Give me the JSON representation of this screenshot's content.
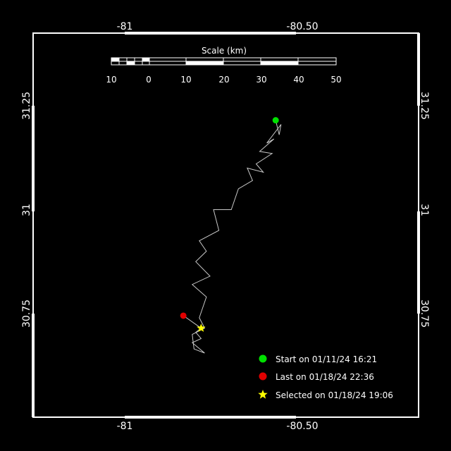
{
  "axes": {
    "lon_ticks": [
      "-81",
      "-80.50"
    ],
    "lat_ticks": [
      "31.25",
      "31",
      "30.75"
    ]
  },
  "scale_bar": {
    "title": "Scale (km)",
    "labels": [
      "10",
      "0",
      "10",
      "20",
      "30",
      "40",
      "50"
    ]
  },
  "legend": {
    "start": "Start on 01/11/24 16:21",
    "last": "Last on 01/18/24 22:36",
    "selected": "Selected on 01/18/24 19:06"
  },
  "colors": {
    "background": "#000000",
    "frame": "#ffffff",
    "track": "#c8c8c8",
    "start": "#00e000",
    "last": "#e00000",
    "selected": "#ffff00"
  },
  "track": {
    "points_lonlat": [
      [
        -80.575,
        31.215
      ],
      [
        -80.565,
        31.18
      ],
      [
        -80.56,
        31.205
      ],
      [
        -80.6,
        31.16
      ],
      [
        -80.58,
        31.17
      ],
      [
        -80.62,
        31.14
      ],
      [
        -80.585,
        31.135
      ],
      [
        -80.63,
        31.11
      ],
      [
        -80.61,
        31.09
      ],
      [
        -80.655,
        31.1
      ],
      [
        -80.64,
        31.07
      ],
      [
        -80.68,
        31.05
      ],
      [
        -80.7,
        31.0
      ],
      [
        -80.75,
        31.0
      ],
      [
        -80.735,
        30.95
      ],
      [
        -80.79,
        30.925
      ],
      [
        -80.77,
        30.9
      ],
      [
        -80.8,
        30.875
      ],
      [
        -80.76,
        30.84
      ],
      [
        -80.81,
        30.82
      ],
      [
        -80.77,
        30.79
      ],
      [
        -80.79,
        30.74
      ],
      [
        -80.775,
        30.715
      ],
      [
        -80.81,
        30.7
      ],
      [
        -80.805,
        30.665
      ],
      [
        -80.775,
        30.655
      ],
      [
        -80.81,
        30.68
      ],
      [
        -80.785,
        30.69
      ],
      [
        -80.8,
        30.705
      ],
      [
        -80.785,
        30.715
      ],
      [
        -80.835,
        30.745
      ]
    ],
    "start_lonlat": [
      -80.575,
      31.215
    ],
    "last_lonlat": [
      -80.835,
      30.745
    ],
    "selected_lonlat": [
      -80.785,
      30.715
    ]
  }
}
